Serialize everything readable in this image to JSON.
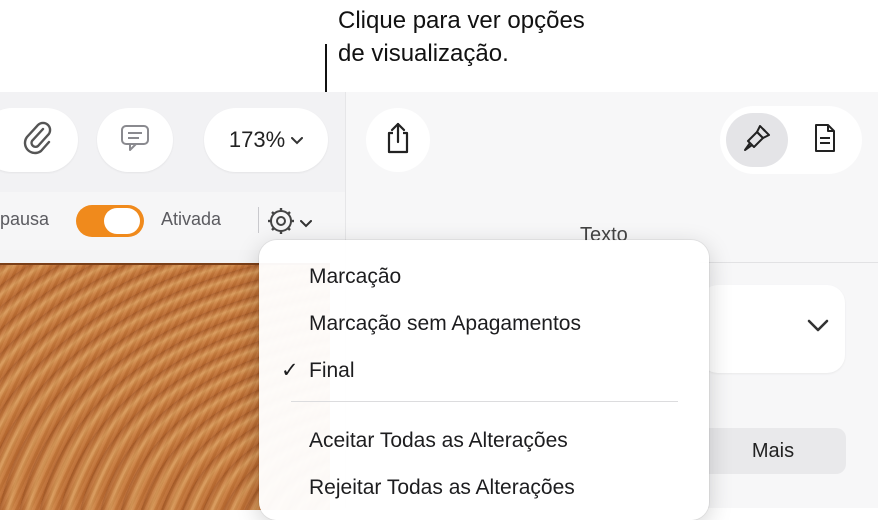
{
  "callout": {
    "line1": "Clique para ver opções",
    "line2": "de visualização."
  },
  "toolbar": {
    "attach_icon": "paperclip-icon",
    "comment_icon": "comment-icon",
    "zoom_value": "173%",
    "share_icon": "share-icon",
    "format_icon": "paintbrush-icon",
    "document_icon": "document-icon"
  },
  "tracking": {
    "left_label": "pausa",
    "right_label": "Ativada",
    "toggle_on": true,
    "toggle_color": "#f08a1c",
    "view_options_icon": "gear-icon"
  },
  "sidebar": {
    "section_title": "Texto",
    "more_button": "Mais"
  },
  "view_menu": {
    "items": [
      {
        "label": "Marcação",
        "checked": false
      },
      {
        "label": "Marcação sem Apagamentos",
        "checked": false
      },
      {
        "label": "Final",
        "checked": true
      },
      {
        "label": "Aceitar Todas as Alterações",
        "checked": false
      },
      {
        "label": "Rejeitar Todas as Alterações",
        "checked": false
      }
    ],
    "check_mark": "✓"
  }
}
